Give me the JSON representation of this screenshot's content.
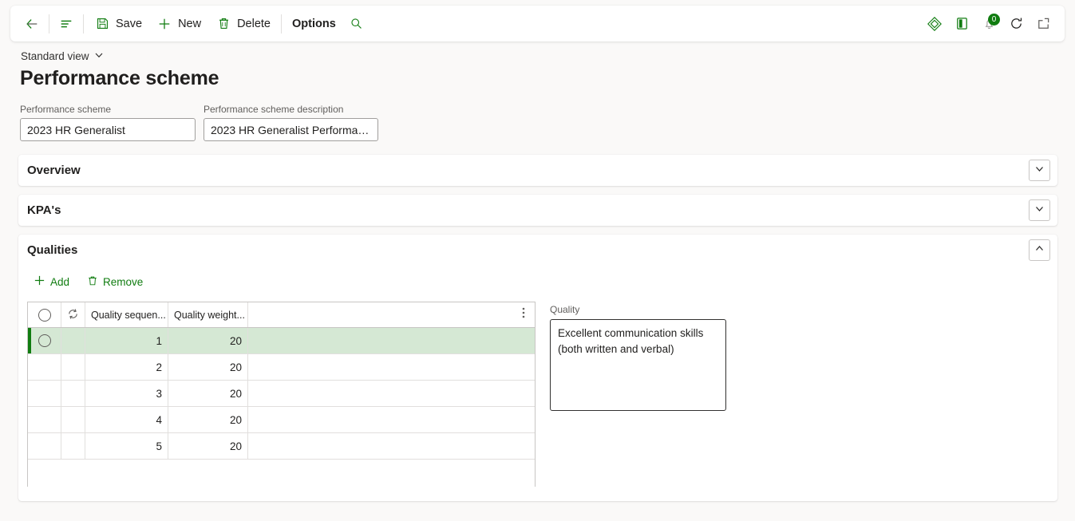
{
  "toolbar": {
    "back_label": "Back",
    "nav_label": "Show navigation",
    "save_label": "Save",
    "new_label": "New",
    "delete_label": "Delete",
    "options_label": "Options",
    "search_label": "Search",
    "right_icons": [
      {
        "name": "dynamics-diamond-icon",
        "title": "Dynamics 365"
      },
      {
        "name": "office-app-icon",
        "title": "Office apps"
      },
      {
        "name": "notifications-bell-icon",
        "title": "Notifications",
        "badge": "0"
      },
      {
        "name": "refresh-icon",
        "title": "Refresh"
      },
      {
        "name": "open-in-new-window-icon",
        "title": "Open in new window"
      }
    ]
  },
  "header": {
    "view_name": "Standard view",
    "page_title": "Performance scheme"
  },
  "fields": {
    "scheme": {
      "label": "Performance scheme",
      "value": "2023 HR Generalist",
      "placeholder": ""
    },
    "description": {
      "label": "Performance scheme description",
      "value": "2023 HR Generalist Performanc...",
      "placeholder": ""
    }
  },
  "sections": [
    {
      "title": "Overview",
      "expanded": false,
      "chevron": "chevron-down-icon"
    },
    {
      "title": "KPA's",
      "expanded": false,
      "chevron": "chevron-down-icon"
    },
    {
      "title": "Qualities",
      "expanded": true,
      "chevron": "chevron-up-icon"
    }
  ],
  "qualities": {
    "grid_toolbar": {
      "add_label": "Add",
      "remove_label": "Remove"
    },
    "grid": {
      "columns": [
        {
          "key": "select",
          "label": "",
          "icon": "radio-circle-icon"
        },
        {
          "key": "refresh",
          "label": "",
          "icon": "row-refresh-icon"
        },
        {
          "key": "sequence",
          "label": "Quality sequen..."
        },
        {
          "key": "weight",
          "label": "Quality weight..."
        }
      ],
      "kebab_label": "More options",
      "rows": [
        {
          "sequence": "1",
          "weight": "20",
          "selected": true
        },
        {
          "sequence": "2",
          "weight": "20",
          "selected": false
        },
        {
          "sequence": "3",
          "weight": "20",
          "selected": false
        },
        {
          "sequence": "4",
          "weight": "20",
          "selected": false
        },
        {
          "sequence": "5",
          "weight": "20",
          "selected": false
        }
      ]
    },
    "detail": {
      "label": "Quality",
      "value": "Excellent communication skills (both written and verbal)",
      "placeholder": ""
    }
  },
  "colors": {
    "accent_green": "#107c10",
    "selected_row": "#d5e8d4",
    "page_bg": "#faf9f8",
    "border": "#c8c6c4"
  }
}
